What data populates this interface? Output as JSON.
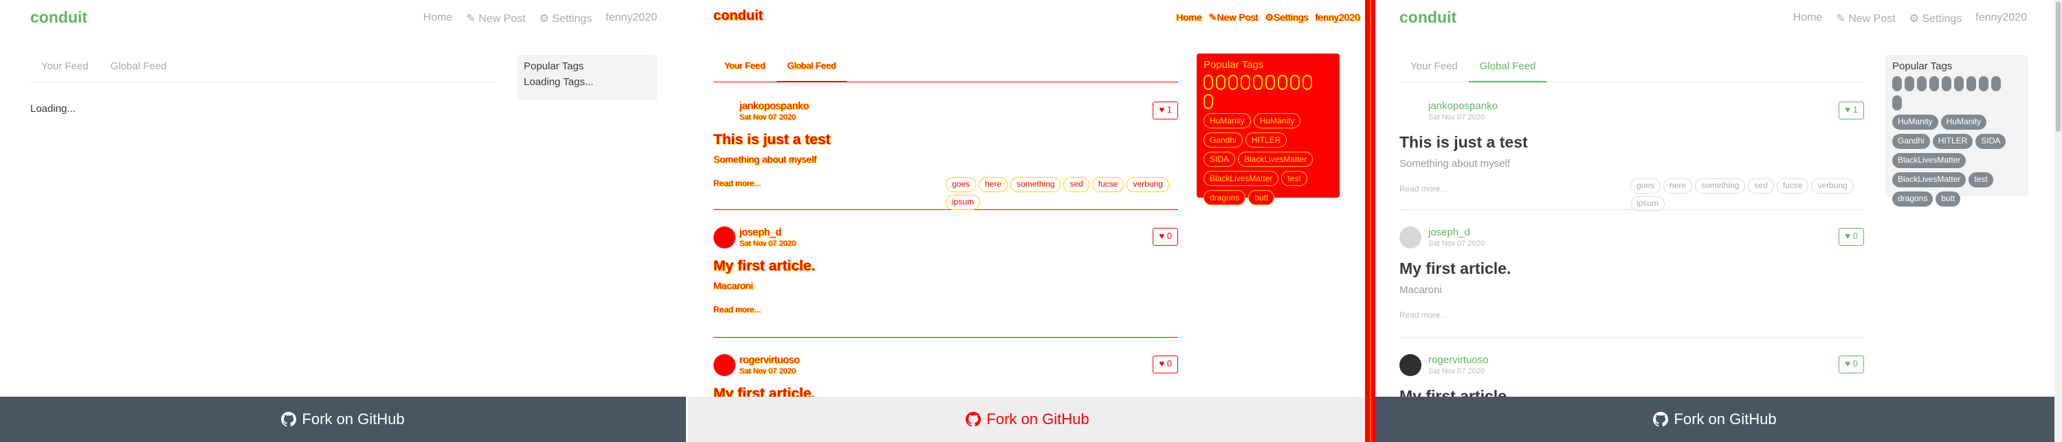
{
  "brand": "conduit",
  "nav": {
    "home": "Home",
    "new_post": "New Post",
    "settings": "Settings",
    "user": "fenny2020"
  },
  "tabs": {
    "your_feed": "Your Feed",
    "global_feed": "Global Feed"
  },
  "loading": "Loading...",
  "sidebar": {
    "title": "Popular Tags",
    "loading": "Loading Tags...",
    "tags": [
      "HuManity",
      "HuManity",
      "Gandhi",
      "HITLER",
      "SIDA",
      "BlackLivesMatter",
      "BlackLivesMatter",
      "test",
      "dragons",
      "butt"
    ]
  },
  "read_more": "Read more...",
  "articles": [
    {
      "author": "jankopospanko",
      "date": "Sat Nov 07 2020",
      "likes": "1",
      "title": "This is just a test",
      "description": "Something about myself",
      "tags": [
        "goes",
        "here",
        "something",
        "sed",
        "fucse",
        "verbung",
        "ipsum"
      ]
    },
    {
      "author": "joseph_d",
      "date": "Sat Nov 07 2020",
      "likes": "0",
      "title": "My first article.",
      "description": "Macaroni",
      "tags": []
    },
    {
      "author": "rogervirtuoso",
      "date": "Sat Nov 07 2020",
      "likes": "0",
      "title": "My first article.",
      "description": "",
      "tags": []
    }
  ],
  "footer": {
    "label": "Fork on GitHub"
  },
  "colors": {
    "accent": "#5cb85c",
    "footer_bg": "#485563",
    "diff_red": "#ff0000",
    "diff_yellow": "#ffd400"
  },
  "icons": {
    "edit": "edit-icon",
    "settings": "gear-icon",
    "like": "heart-icon",
    "github": "github-icon"
  }
}
